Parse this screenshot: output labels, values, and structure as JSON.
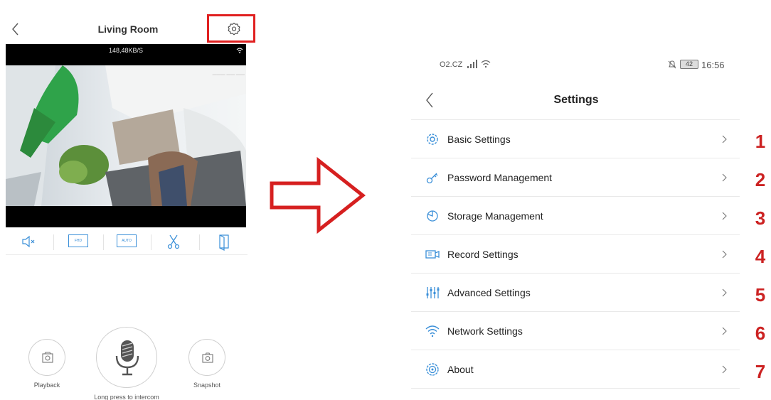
{
  "left_screen": {
    "title": "Living Room",
    "bitrate": "148,48KB/S",
    "controls": {
      "hd_label": "FHD",
      "auto_label": "AUTO"
    },
    "bottom": {
      "playback_label": "Playback",
      "intercom_label": "Long press to intercom",
      "snapshot_label": "Snapshot"
    },
    "icons": [
      "back-icon",
      "settings-gear-icon",
      "mute-icon",
      "hd-icon",
      "auto-icon",
      "cut-icon",
      "door-icon",
      "playback-icon",
      "microphone-icon",
      "snapshot-icon"
    ]
  },
  "right_screen": {
    "status": {
      "carrier": "O2.CZ",
      "time": "16:56",
      "battery": "42"
    },
    "title": "Settings",
    "items": [
      {
        "label": "Basic Settings",
        "number": "1",
        "icon": "gear-icon"
      },
      {
        "label": "Password Management",
        "number": "2",
        "icon": "key-icon"
      },
      {
        "label": "Storage Management",
        "number": "3",
        "icon": "storage-icon"
      },
      {
        "label": "Record Settings",
        "number": "4",
        "icon": "camera-record-icon"
      },
      {
        "label": "Advanced Settings",
        "number": "5",
        "icon": "sliders-icon"
      },
      {
        "label": "Network Settings",
        "number": "6",
        "icon": "wifi-icon"
      },
      {
        "label": "About",
        "number": "7",
        "icon": "info-gear-icon"
      }
    ]
  },
  "colors": {
    "accent_blue": "#3a8fd8",
    "highlight_red": "#e02020",
    "number_red": "#cc2222"
  }
}
